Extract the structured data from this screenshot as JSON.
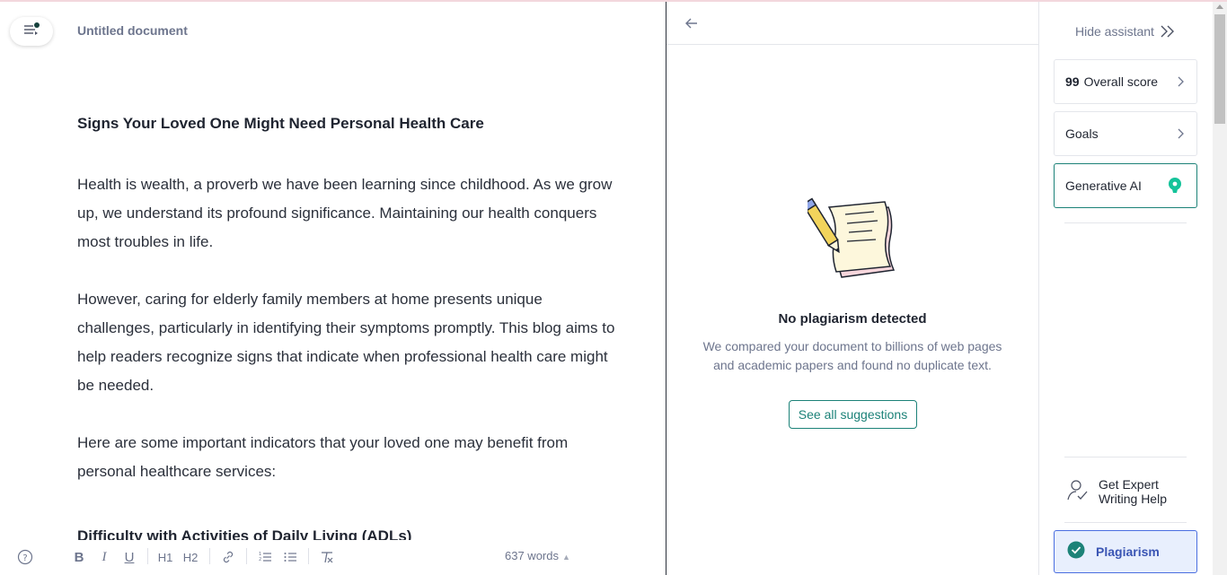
{
  "editor": {
    "doc_title": "Untitled document",
    "heading": "Signs Your Loved One Might Need Personal Health Care",
    "paragraphs": [
      "Health is wealth, a proverb we have been learning since childhood. As we grow up, we understand its profound significance. Maintaining our health conquers most troubles in life.",
      "However, caring for elderly family members at home presents unique challenges, particularly in identifying their symptoms promptly. This blog aims to help readers recognize signs that indicate when professional health care might be needed.",
      "Here are some important indicators that your loved one may benefit from personal healthcare services:"
    ],
    "subheading": "Difficulty with Activities of Daily Living (ADLs)"
  },
  "toolbar": {
    "bold": "B",
    "italic": "I",
    "underline": "U",
    "h1": "H1",
    "h2": "H2",
    "word_count": "637 words"
  },
  "panel": {
    "no_plag_title": "No plagiarism detected",
    "no_plag_desc": "We compared your document to billions of web pages and academic papers and found no duplicate text.",
    "see_all_label": "See all suggestions"
  },
  "sidebar": {
    "hide_label": "Hide assistant",
    "score_value": "99",
    "score_label": "Overall score",
    "goals_label": "Goals",
    "genai_label": "Generative AI",
    "expert_line1": "Get Expert",
    "expert_line2": "Writing Help",
    "plagiarism_label": "Plagiarism"
  },
  "colors": {
    "accent_green": "#1c8278",
    "plagiarism_blue": "#3a55b4",
    "text_muted": "#6d758d"
  }
}
